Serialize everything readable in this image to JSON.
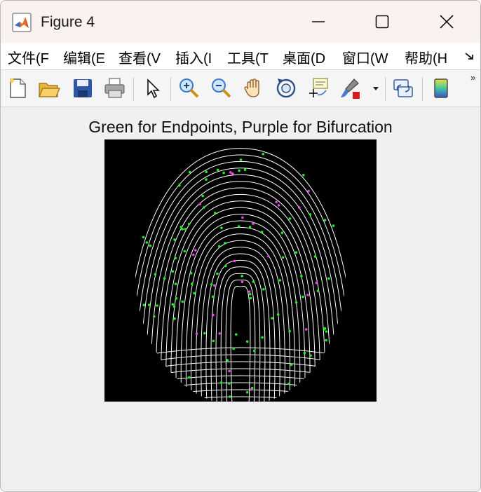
{
  "window": {
    "title": "Figure 4"
  },
  "menu": {
    "items": [
      {
        "label": "文件(F"
      },
      {
        "label": "编辑(E"
      },
      {
        "label": "查看(V"
      },
      {
        "label": "插入(I"
      },
      {
        "label": "工具(T"
      },
      {
        "label": "桌面(D"
      },
      {
        "label": "窗口(W"
      },
      {
        "label": "帮助(H"
      }
    ]
  },
  "toolbar": {
    "icons": [
      "new-figure-icon",
      "open-file-icon",
      "save-icon",
      "print-icon",
      "select-pointer-icon",
      "zoom-in-icon",
      "zoom-out-icon",
      "pan-hand-icon",
      "rotate-3d-icon",
      "data-cursor-icon",
      "brush-icon",
      "brush-dropdown-icon",
      "link-plot-icon",
      "colorbar-icon"
    ],
    "overflow_label": "»"
  },
  "figure": {
    "title": "Green for Endpoints, Purple for Bifurcation",
    "colors": {
      "endpoint": "#22ee22",
      "bifurcation": "#ee44ee",
      "ridge": "#ffffff",
      "background": "#000000"
    }
  }
}
